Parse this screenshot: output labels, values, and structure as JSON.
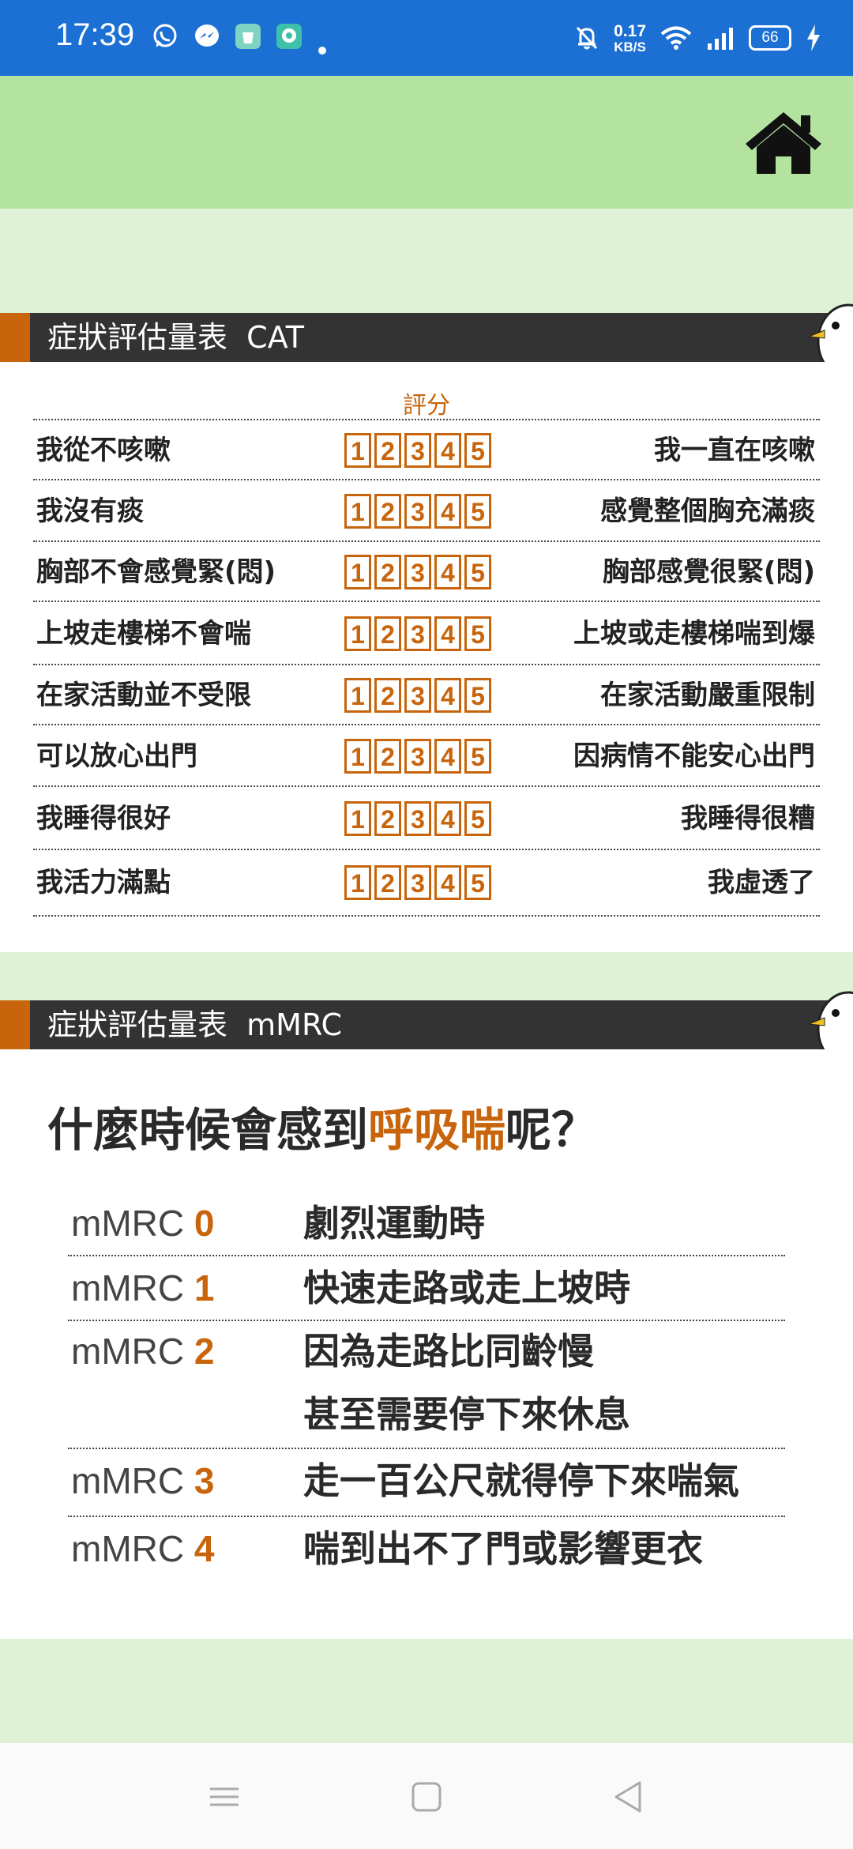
{
  "status_bar": {
    "time": "17:39",
    "network_speed_value": "0.17",
    "network_speed_unit": "KB/S",
    "battery": "66",
    "app_icons": [
      "whatsapp-icon",
      "messenger-icon",
      "shopping-icon",
      "chat-icon"
    ],
    "colors": {
      "background": "#1d70d3"
    }
  },
  "header": {
    "home_icon": "home-icon",
    "colors": {
      "background": "#b4e3a0",
      "page": "#dff2d6"
    }
  },
  "cat": {
    "title": "症狀評估量表  CAT",
    "score_header": "評分",
    "score_options": [
      "1",
      "2",
      "3",
      "4",
      "5"
    ],
    "rows": [
      {
        "left": "我從不咳嗽",
        "right": "我一直在咳嗽"
      },
      {
        "left": "我沒有痰",
        "right": "感覺整個胸充滿痰"
      },
      {
        "left": "胸部不會感覺緊(悶)",
        "right": "胸部感覺很緊(悶)"
      },
      {
        "left": "上坡走樓梯不會喘",
        "right": "上坡或走樓梯喘到爆"
      },
      {
        "left": "在家活動並不受限",
        "right": "在家活動嚴重限制"
      },
      {
        "left": "可以放心出門",
        "right": "因病情不能安心出門"
      },
      {
        "left": "我睡得很好",
        "right": "我睡得很糟"
      },
      {
        "left": "我活力滿點",
        "right": "我虛透了"
      }
    ],
    "colors": {
      "accent": "#c8640b",
      "bar": "#333333"
    }
  },
  "mmrc": {
    "title": "症狀評估量表  mMRC",
    "question_prefix": "什麼時候會感到",
    "question_highlight": "呼吸喘",
    "question_suffix": "呢？",
    "levels": [
      {
        "prefix": "mMRC ",
        "level": "0",
        "desc": [
          "劇烈運動時"
        ]
      },
      {
        "prefix": "mMRC ",
        "level": "1",
        "desc": [
          "快速走路或走上坡時"
        ]
      },
      {
        "prefix": "mMRC ",
        "level": "2",
        "desc": [
          "因為走路比同齡慢",
          "甚至需要停下來休息"
        ]
      },
      {
        "prefix": "mMRC ",
        "level": "3",
        "desc": [
          "走一百公尺就得停下來喘氣"
        ]
      },
      {
        "prefix": "mMRC ",
        "level": "4",
        "desc": [
          "喘到出不了門或影響更衣"
        ]
      }
    ]
  },
  "nav_bar": {
    "buttons": [
      "menu-icon",
      "home-square-icon",
      "back-icon"
    ]
  }
}
